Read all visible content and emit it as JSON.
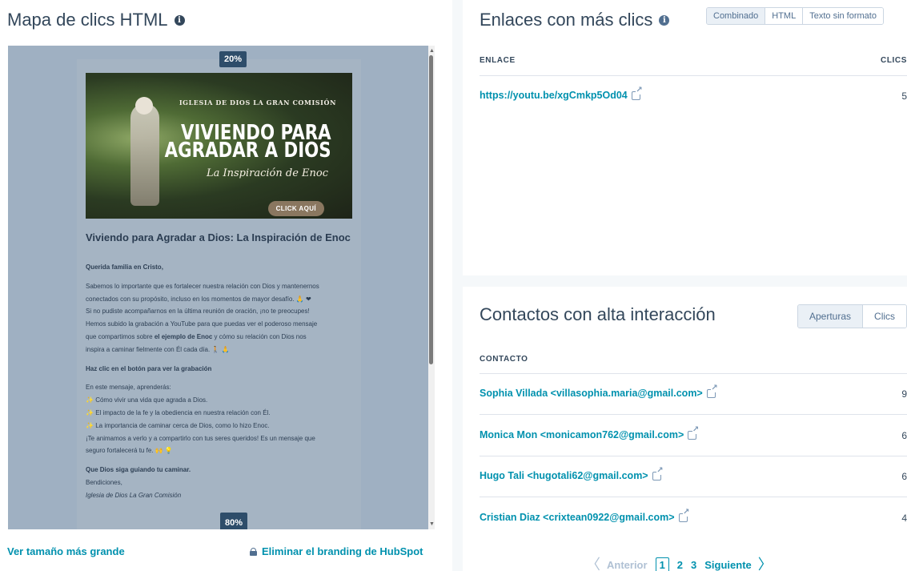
{
  "heatmap": {
    "title": "Mapa de clics HTML",
    "top_badge": "20%",
    "bottom_badge": "80%",
    "view_larger": "Ver tamaño más grande",
    "remove_branding": "Eliminar el branding de HubSpot"
  },
  "email": {
    "banner_org": "IGLESIA DE DIOS LA GRAN COMISIÓN",
    "banner_title_1": "VIVIENDO PARA",
    "banner_title_2": "AGRADAR A DIOS",
    "banner_subtitle": "La Inspiración de Enoc",
    "banner_button": "CLICK AQUÍ",
    "headline": "Viviendo para Agradar a Dios: La Inspiración de Enoc",
    "greeting": "Querida familia en Cristo,",
    "p1_l1": "Sabemos lo importante que es fortalecer nuestra relación con Dios y mantenernos",
    "p1_l2": "conectados con su propósito, incluso en los momentos de mayor desafío. 🙏 ❤",
    "p1_l3": "Si no pudiste acompañarnos en la última reunión de oración, ¡no te preocupes!",
    "p1_l4": "Hemos subido la grabación a YouTube para que puedas ver el poderoso mensaje",
    "p1_l5a": "que compartimos sobre ",
    "p1_l5b": "el ejemplo de Enoc",
    "p1_l5c": " y cómo su relación con Dios nos",
    "p1_l6": "inspira a caminar fielmente con Él cada día. 🚶 🙏",
    "cta_text": "Haz clic en el botón para ver la grabación",
    "learn_intro": "En este mensaje, aprenderás:",
    "learn_1": "Cómo vivir una vida que agrada a Dios.",
    "learn_2": "El impacto de la fe y la obediencia en nuestra relación con Él.",
    "learn_3": "La importancia de caminar cerca de Dios, como lo hizo Enoc.",
    "share_l1": "¡Te animamos a verlo y a compartirlo con tus seres queridos! Es un mensaje que",
    "share_l2": "seguro fortalecerá tu fe. 🙌 💡",
    "closing": "Que Dios siga guiando tu caminar.",
    "blessing": "Bendiciones,",
    "signature": "Iglesia de Dios La Gran Comisión",
    "spark": "✨"
  },
  "links_card": {
    "title": "Enlaces con más clics",
    "tabs": [
      "Combinado",
      "HTML",
      "Texto sin formato"
    ],
    "col_link": "ENLACE",
    "col_clicks": "CLICS",
    "rows": [
      {
        "url": "https://youtu.be/xgCmkp5Od04",
        "clicks": "5"
      }
    ]
  },
  "contacts_card": {
    "title": "Contactos con alta interacción",
    "tabs": [
      "Aperturas",
      "Clics"
    ],
    "col_contact": "CONTACTO",
    "rows": [
      {
        "name": "Sophia Villada <villasophia.maria@gmail.com>",
        "value": "9"
      },
      {
        "name": "Monica Mon <monicamon762@gmail.com>",
        "value": "6"
      },
      {
        "name": "Hugo Tali <hugotali62@gmail.com>",
        "value": "6"
      },
      {
        "name": "Cristian Diaz <crixtean0922@gmail.com>",
        "value": "4"
      }
    ],
    "pager": {
      "prev": "Anterior",
      "pages": [
        "1",
        "2",
        "3"
      ],
      "next": "Siguiente"
    }
  },
  "icons": {
    "info": "info-icon",
    "external_link": "external-link-icon",
    "lock": "lock-icon",
    "chevron_left": "chevron-left-icon",
    "chevron_right": "chevron-right-icon"
  }
}
